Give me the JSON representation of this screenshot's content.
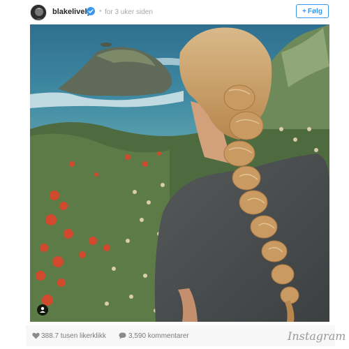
{
  "header": {
    "username": "blakelively",
    "time_ago": "for 3 uker siden",
    "separator": "•",
    "follow_label": "Følg",
    "follow_icon": "+"
  },
  "footer": {
    "likes": "388.7 tusen likerklikk",
    "comments": "3,590 kommentarer",
    "brand": "Instagram"
  },
  "icons": {
    "verified": "verified-badge-icon",
    "like": "heart-icon",
    "comment": "comment-bubble-icon",
    "user_tag": "person-icon"
  },
  "colors": {
    "accent": "#3897f0",
    "verified": "#3897f0",
    "muted_text": "#a5a7aa"
  }
}
